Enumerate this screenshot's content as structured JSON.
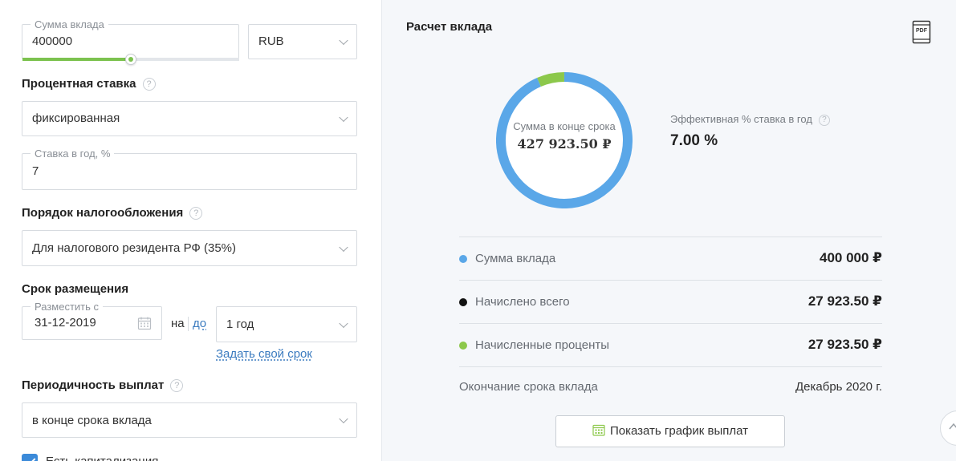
{
  "form": {
    "deposit_amount": {
      "label": "Сумма вклада",
      "value": "400000",
      "slider_fraction": 0.5
    },
    "currency": {
      "value": "RUB"
    },
    "interest_rate": {
      "title": "Процентная ставка",
      "help": "?",
      "type_value": "фиксированная",
      "rate_label": "Ставка в год, %",
      "rate_value": "7"
    },
    "taxation": {
      "title": "Порядок налогообложения",
      "help": "?",
      "value": "Для налогового резидента РФ (35%)"
    },
    "term": {
      "title": "Срок размещения",
      "start_label": "Разместить с",
      "start_value": "31-12-2019",
      "on_text": "на",
      "until_link": "до",
      "duration_value": "1 год",
      "custom_link": "Задать свой срок"
    },
    "payout_frequency": {
      "title": "Периодичность выплат",
      "help": "?",
      "value": "в конце срока вклада"
    },
    "capitalization": {
      "label": "Есть капитализация",
      "checked": true
    }
  },
  "result": {
    "title": "Расчет вклада",
    "pdf_icon_text": "PDF",
    "donut": {
      "center_label": "Сумма в конце срока",
      "center_value": "427 923.50 ₽",
      "principal_color": "#5aa7e8",
      "interest_color": "#8cc84b",
      "principal_value": 400000,
      "interest_value": 27923.5
    },
    "effective_rate": {
      "label": "Эффективная % ставка в год",
      "help": "?",
      "value": "7.00 %"
    },
    "rows": [
      {
        "label": "Сумма вклада",
        "value": "400 000 ₽",
        "dot_color": "#5aa7e8"
      },
      {
        "label": "Начислено всего",
        "value": "27 923.50 ₽",
        "dot_color": "#111111"
      },
      {
        "label": "Начисленные проценты",
        "value": "27 923.50 ₽",
        "dot_color": "#8cc84b"
      }
    ],
    "end_date": {
      "label": "Окончание срока вклада",
      "value": "Декабрь 2020 г."
    },
    "schedule_button": "Показать график выплат"
  }
}
